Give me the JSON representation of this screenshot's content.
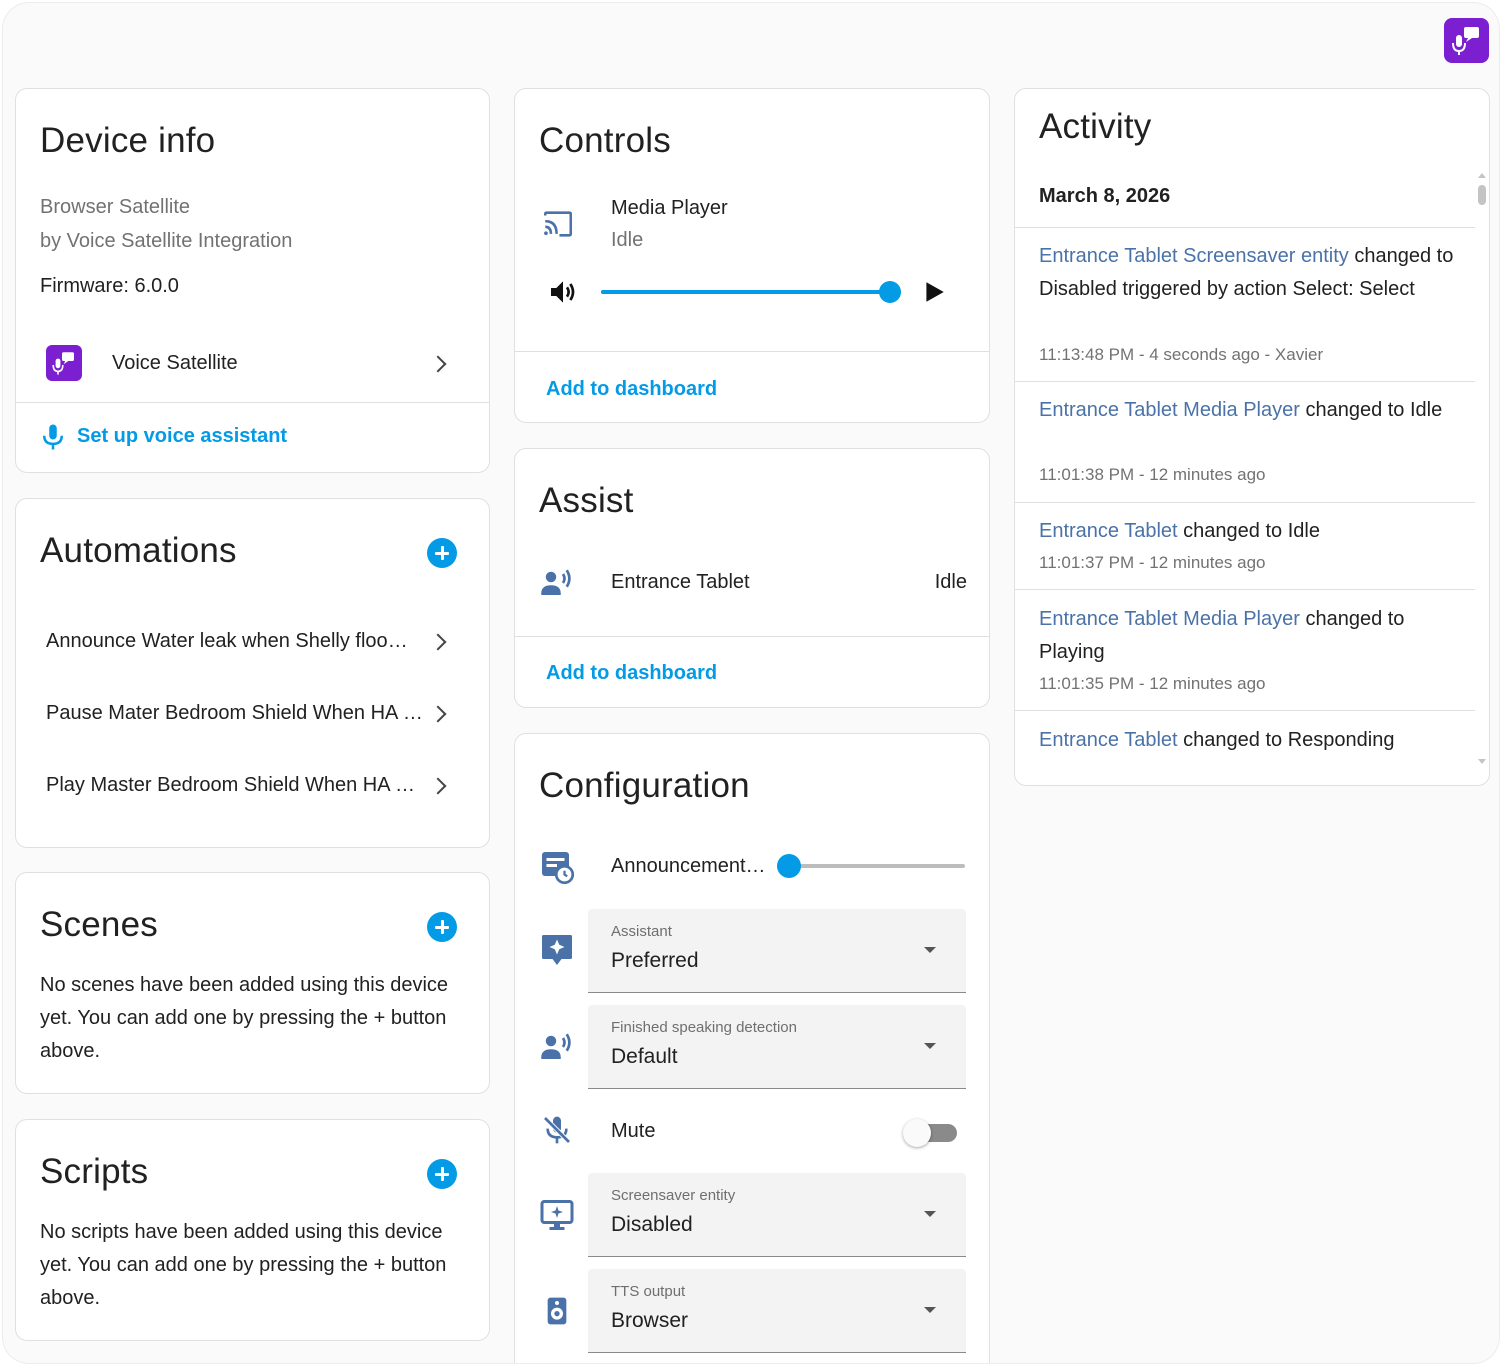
{
  "header": {
    "app_icon": "voice-satellite-icon",
    "accent": "#7b1fd1"
  },
  "device_info": {
    "title": "Device info",
    "model": "Browser Satellite",
    "manufacturer": "by Voice Satellite Integration",
    "firmware": "Firmware: 6.0.0",
    "integration_label": "Voice Satellite",
    "setup_voice_label": "Set up voice assistant"
  },
  "automations": {
    "title": "Automations",
    "items": [
      "Announce Water leak when Shelly flood sensor",
      "Pause Mater Bedroom Shield When HA Stopped",
      "Play Master Bedroom Shield When HA Started"
    ]
  },
  "scenes": {
    "title": "Scenes",
    "empty_text": "No scenes have been added using this device yet. You can add one by pressing the + button above."
  },
  "scripts": {
    "title": "Scripts",
    "empty_text": "No scripts have been added using this device yet. You can add one by pressing the + button above."
  },
  "controls": {
    "title": "Controls",
    "media_name": "Media Player",
    "media_state": "Idle",
    "volume": 1.0,
    "add_label": "Add to dashboard"
  },
  "assist": {
    "title": "Assist",
    "entity_name": "Entrance Tablet",
    "entity_state": "Idle",
    "add_label": "Add to dashboard"
  },
  "configuration": {
    "title": "Configuration",
    "announcement_label": "Announcement volume",
    "announcement_level": 0.0,
    "selects": [
      {
        "label": "Assistant",
        "value": "Preferred"
      },
      {
        "label": "Finished speaking detection",
        "value": "Default"
      },
      {
        "label": "Screensaver entity",
        "value": "Disabled"
      },
      {
        "label": "TTS output",
        "value": "Browser"
      }
    ],
    "mute_label": "Mute",
    "mute_on": false
  },
  "activity": {
    "title": "Activity",
    "date": "March 8, 2026",
    "items": [
      {
        "entity": "Entrance Tablet Screensaver entity",
        "text": " changed to Disabled triggered by action Select: Select",
        "time": "11:13:48 PM - 4 seconds ago - Xavier"
      },
      {
        "entity": "Entrance Tablet Media Player",
        "text": " changed to Idle",
        "time": "11:01:38 PM - 12 minutes ago"
      },
      {
        "entity": "Entrance Tablet",
        "text": " changed to Idle",
        "time": "11:01:37 PM - 12 minutes ago"
      },
      {
        "entity": "Entrance Tablet Media Player",
        "text": " changed to Playing",
        "time": "11:01:35 PM - 12 minutes ago"
      },
      {
        "entity": "Entrance Tablet",
        "text": " changed to Responding",
        "time": ""
      }
    ]
  }
}
